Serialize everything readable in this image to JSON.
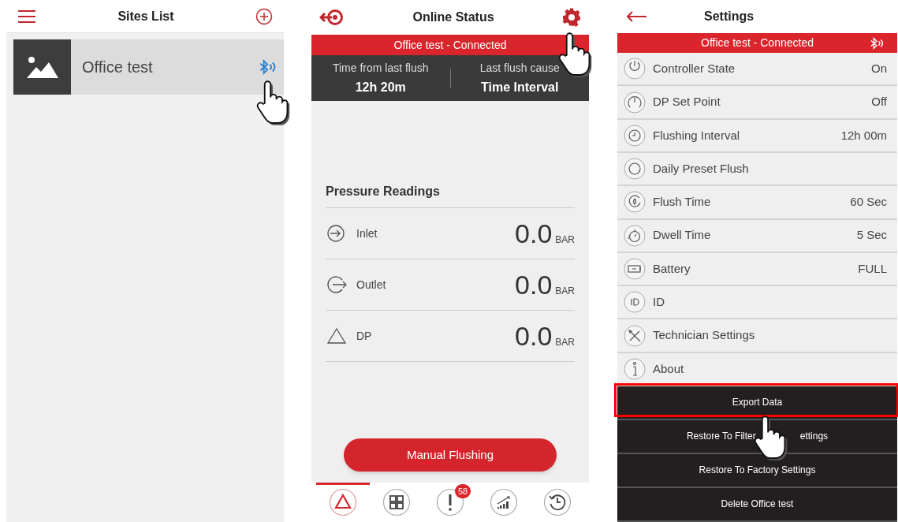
{
  "sites_list": {
    "title": "Sites List",
    "sites": [
      {
        "name": "Office test",
        "connected": true
      }
    ]
  },
  "online_status": {
    "title": "Online Status",
    "banner": "Office test - Connected",
    "stats": [
      {
        "label": "Time from last flush",
        "value": "12h 20m"
      },
      {
        "label": "Last flush cause",
        "value": "Time Interval"
      }
    ],
    "readings_title": "Pressure Readings",
    "readings": [
      {
        "kind": "inlet",
        "label": "Inlet",
        "value": "0.0",
        "unit": "BAR"
      },
      {
        "kind": "outlet",
        "label": "Outlet",
        "value": "0.0",
        "unit": "BAR"
      },
      {
        "kind": "dp",
        "label": "DP",
        "value": "0.0",
        "unit": "BAR"
      }
    ],
    "action": "Manual Flushing",
    "nav": [
      {
        "kind": "alert",
        "selected": true
      },
      {
        "kind": "grid",
        "selected": false
      },
      {
        "kind": "exclamation",
        "selected": false,
        "badge": "58"
      },
      {
        "kind": "chart",
        "selected": false
      },
      {
        "kind": "history",
        "selected": false
      }
    ]
  },
  "settings": {
    "title": "Settings",
    "banner": "Office test - Connected",
    "rows": [
      {
        "kind": "power",
        "label": "Controller State",
        "value": "On"
      },
      {
        "kind": "gauge",
        "label": "DP Set Point",
        "value": "Off"
      },
      {
        "kind": "clock",
        "label": "Flushing Interval",
        "value": "12h 00m"
      },
      {
        "kind": "daily",
        "label": "Daily Preset Flush"
      },
      {
        "kind": "drop",
        "label": "Flush Time",
        "value": "60 Sec"
      },
      {
        "kind": "stopwatch",
        "label": "Dwell Time",
        "value": "5 Sec"
      },
      {
        "kind": "battery",
        "label": "Battery",
        "value": "FULL"
      },
      {
        "kind": "id",
        "label": "ID"
      },
      {
        "kind": "tools",
        "label": "Technician Settings"
      },
      {
        "kind": "info",
        "label": "About"
      }
    ],
    "actions": [
      {
        "label_parts": [
          "Export Data"
        ],
        "highlighted": true
      },
      {
        "label_parts": [
          "Restore To Filter",
          "ettings"
        ],
        "highlighted": false
      },
      {
        "label_parts": [
          "Restore To Factory Settings"
        ],
        "highlighted": false
      },
      {
        "label_parts": [
          "Delete Office test"
        ],
        "highlighted": false
      }
    ]
  }
}
